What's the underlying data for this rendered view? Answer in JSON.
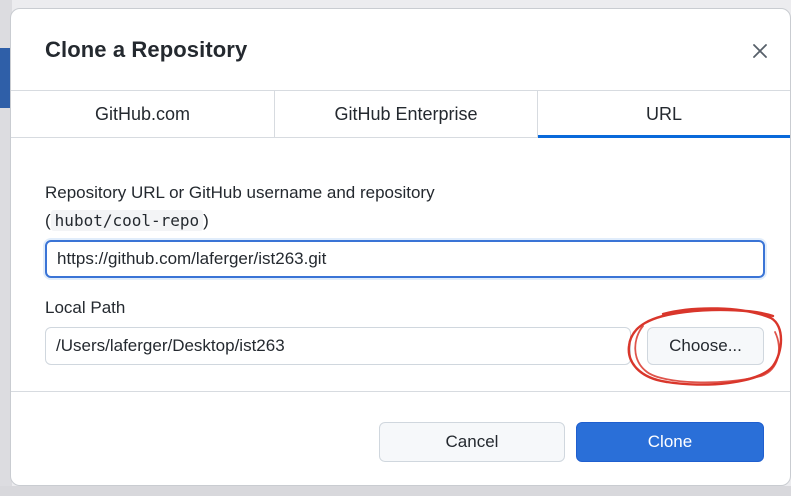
{
  "dialog": {
    "title": "Clone a Repository",
    "close_icon": "close-icon"
  },
  "tabs": [
    {
      "label": "GitHub.com",
      "active": false
    },
    {
      "label": "GitHub Enterprise",
      "active": false
    },
    {
      "label": "URL",
      "active": true
    }
  ],
  "form": {
    "repo_label": "Repository URL or GitHub username and repository",
    "repo_hint_open": "(",
    "repo_hint_code": "hubot/cool-repo",
    "repo_hint_close": ")",
    "repo_value": "https://github.com/laferger/ist263.git",
    "local_label": "Local Path",
    "local_value": "/Users/laferger/Desktop/ist263",
    "choose_label": "Choose..."
  },
  "footer": {
    "cancel_label": "Cancel",
    "clone_label": "Clone"
  },
  "colors": {
    "accent": "#0969da",
    "primary_button": "#2a6fd8",
    "annotation_circle": "#d9362b"
  }
}
